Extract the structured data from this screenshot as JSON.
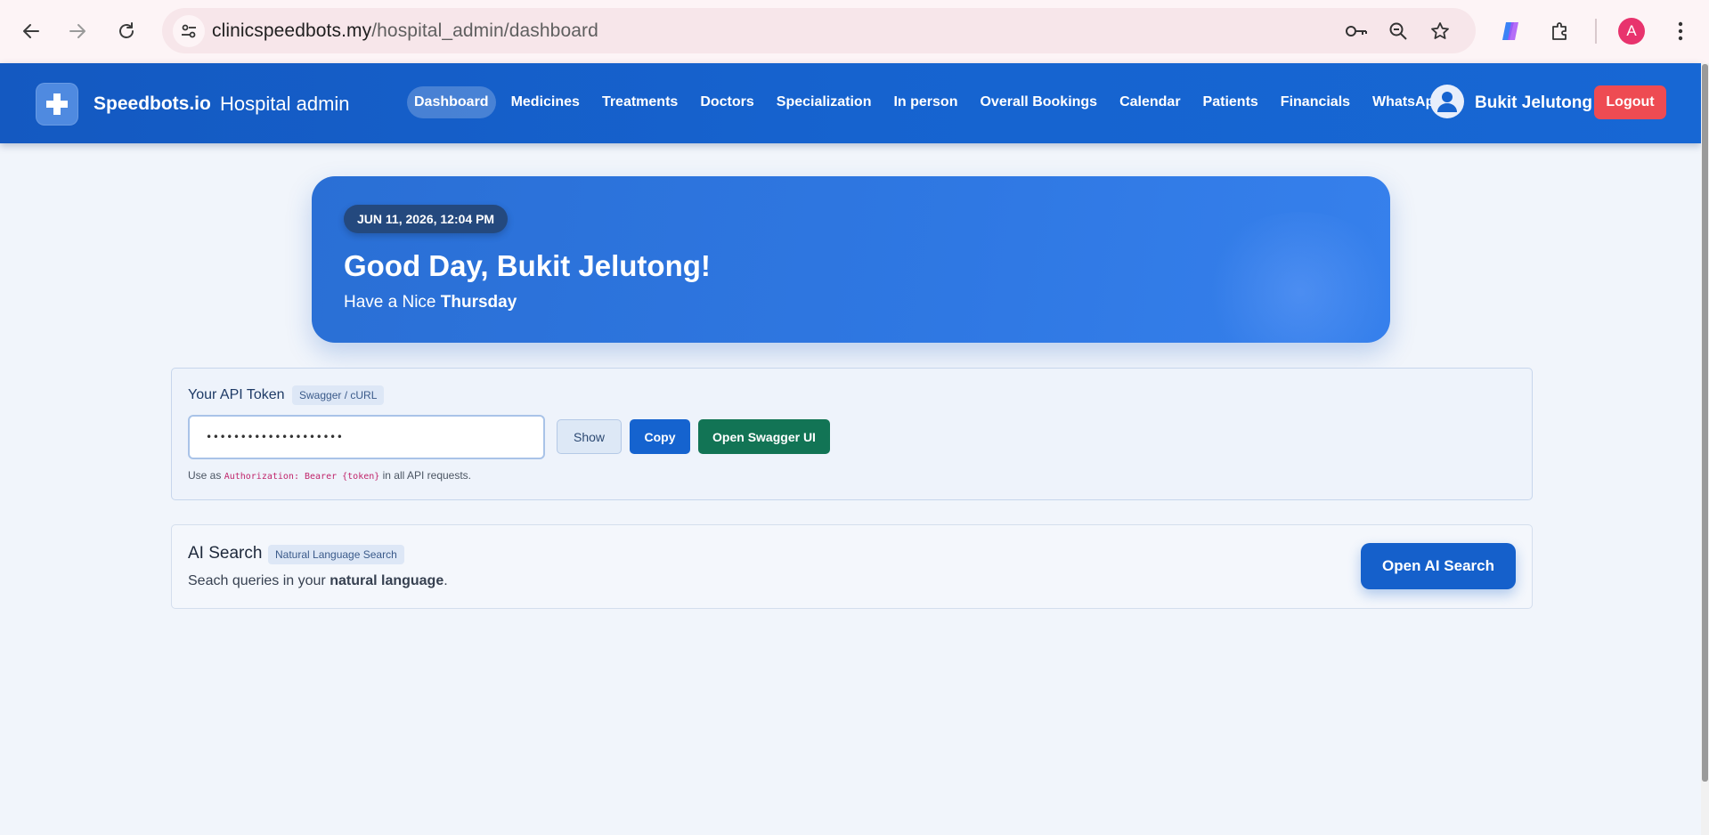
{
  "browser": {
    "url_host": "clinicspeedbots.my",
    "url_path": "/hospital_admin/dashboard",
    "profile_initial": "A",
    "icons": [
      "back-arrow-icon",
      "forward-arrow-icon",
      "reload-icon",
      "site-settings-icon",
      "key-icon",
      "zoom-icon",
      "star-icon",
      "copilot-icon",
      "extensions-icon",
      "kebab-menu-icon"
    ]
  },
  "header": {
    "brand": "Speedbots.io",
    "subtitle": "Hospital admin",
    "nav": [
      {
        "label": "Dashboard",
        "active": true
      },
      {
        "label": "Medicines"
      },
      {
        "label": "Treatments"
      },
      {
        "label": "Doctors"
      },
      {
        "label": "Specialization"
      },
      {
        "label": "In person"
      },
      {
        "label": "Overall Bookings"
      },
      {
        "label": "Calendar"
      },
      {
        "label": "Patients"
      },
      {
        "label": "Financials"
      },
      {
        "label": "WhatsApp"
      }
    ],
    "user_name": "Bukit Jelutong",
    "logout_label": "Logout"
  },
  "hero": {
    "datetime": "JUN 11, 2026, 12:04 PM",
    "greeting": "Good Day, Bukit Jelutong!",
    "sub_prefix": "Have a Nice ",
    "day": "Thursday"
  },
  "api_token": {
    "title": "Your API Token",
    "chip": "Swagger / cURL",
    "masked_value": "••••••••••••••••••••",
    "show_label": "Show",
    "copy_label": "Copy",
    "swagger_label": "Open Swagger UI",
    "hint_prefix": "Use as ",
    "hint_code": "Authorization: Bearer {token}",
    "hint_suffix": " in all API requests."
  },
  "ai_search": {
    "title": "AI Search",
    "chip": "Natural Language Search",
    "desc_prefix": "Seach queries in your ",
    "desc_bold": "natural language",
    "desc_suffix": ".",
    "button_label": "Open AI Search"
  },
  "colors": {
    "header_bg": "#1663cf",
    "logout_bg": "#ee4b52",
    "hero_bg": "#2f78e3",
    "copy_btn": "#1563cf",
    "swagger_btn": "#127455",
    "page_bg": "#f1f5fb"
  }
}
